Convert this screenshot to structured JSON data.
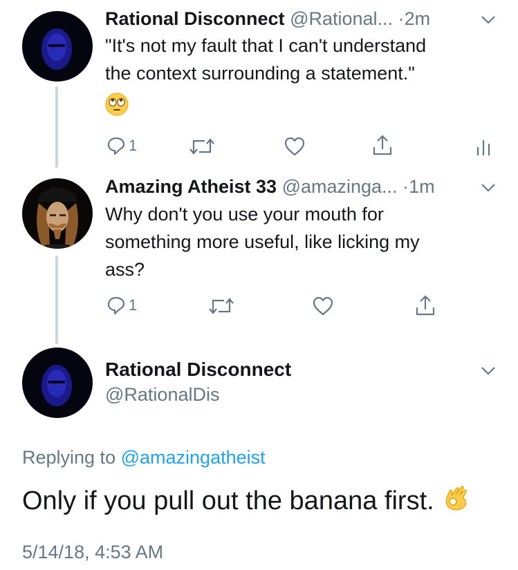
{
  "tweets": [
    {
      "name": "Rational Disconnect",
      "handle": "@Rational...",
      "sep": "·",
      "time": "2m",
      "lines": [
        "\"It's not my fault that I can't understand",
        "the context surrounding a statement.\""
      ],
      "emoji": "face-with-rolling-eyes",
      "reply_count": "1",
      "icons": [
        "reply-icon",
        "retweet-icon",
        "like-icon",
        "share-icon",
        "analytics-icon"
      ]
    },
    {
      "name": "Amazing Atheist 33",
      "handle": "@amazinga...",
      "sep": "·",
      "time": "1m",
      "lines": [
        "Why don't you use your mouth for",
        "something more useful, like licking my",
        "ass?"
      ],
      "reply_count": "1",
      "icons": [
        "reply-icon",
        "retweet-icon",
        "like-icon",
        "share-icon"
      ]
    }
  ],
  "focus": {
    "name": "Rational Disconnect",
    "handle": "@RationalDis",
    "replying_prefix": "Replying to",
    "replying_handle": "@amazingatheist",
    "text": "Only if you pull out the banana first.",
    "emoji": "ok-hand",
    "timestamp": "5/14/18, 4:53 AM"
  },
  "colors": {
    "text": "#14171a",
    "muted": "#657786",
    "link": "#1da1f2",
    "thread_line": "#ccd6dd"
  }
}
